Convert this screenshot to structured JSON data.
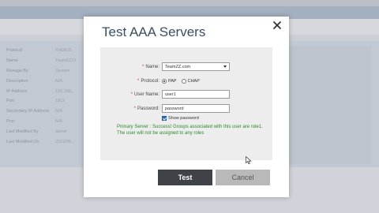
{
  "background": {
    "rows": [
      {
        "label": "Protocol",
        "value": "RADIUS"
      },
      {
        "label": "Name",
        "value": "TeamGCO"
      },
      {
        "label": "Manage By",
        "value": "System"
      },
      {
        "label": "Description",
        "value": "N/A"
      },
      {
        "label": "IP Address",
        "value": "192.168..."
      },
      {
        "label": "Port",
        "value": "1812"
      },
      {
        "label": "Secondary IP Address",
        "value": "N/A"
      },
      {
        "label": "Port",
        "value": "N/A"
      },
      {
        "label": "Last Modified By",
        "value": "admin"
      },
      {
        "label": "Last Modified On",
        "value": "2022/05..."
      }
    ]
  },
  "modal": {
    "title": "Test AAA Servers",
    "form": {
      "name_label": "Name:",
      "name_value": "TeamZZ.com",
      "protocol_label": "Protocol:",
      "protocol_options": [
        "PAP",
        "CHAP"
      ],
      "protocol_selected": "PAP",
      "username_label": "User Name:",
      "username_value": "user1",
      "password_label": "Password:",
      "password_value": "password",
      "show_password_label": "Show password"
    },
    "result_text": "Primary Server : Success! Groups associated with this user are role1. The user will not be assigned to any roles",
    "test_button": "Test",
    "cancel_button": "Cancel"
  },
  "colors": {
    "success": "#2b8a2b",
    "primary_button": "#3f4347",
    "secondary_button": "#b9b9b9",
    "title": "#3b4e62"
  }
}
